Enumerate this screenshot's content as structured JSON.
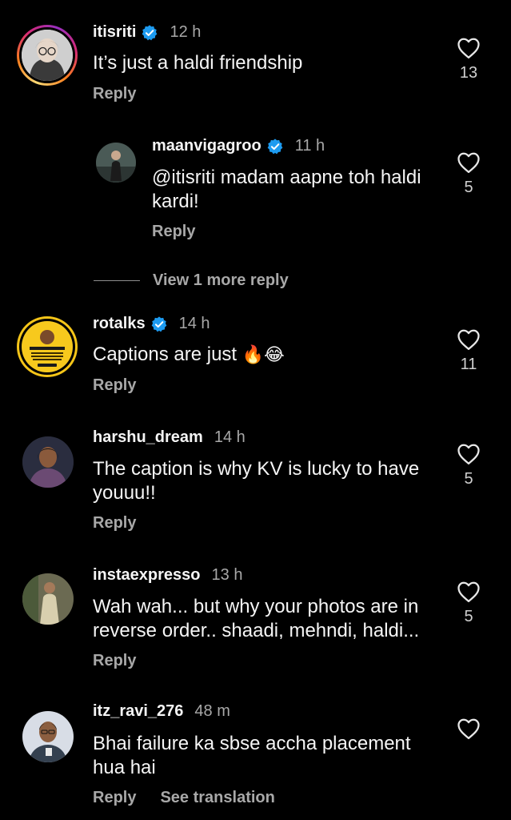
{
  "colors": {
    "background": "#000000",
    "text": "#f5f5f5",
    "muted": "#a8a8a8",
    "verified": "#1d9bf0",
    "story_ring": [
      "#feda75",
      "#fa7e1e",
      "#d62976",
      "#962fbf"
    ],
    "rotalks_ring": "#f5c518"
  },
  "comments": [
    {
      "username": "itisriti",
      "verified": true,
      "time": "12 h",
      "text": "It’s just a haldi friendship",
      "likes": "13",
      "reply_label": "Reply",
      "avatar_icon": "profile-photo"
    },
    {
      "username": "maanvigagroo",
      "verified": true,
      "time": "11 h",
      "text_line1": "@itisriti madam aapne toh haldi",
      "text_line2": "kardi!",
      "likes": "5",
      "reply_label": "Reply",
      "avatar_icon": "profile-photo"
    },
    {
      "username": "rotalks",
      "verified": true,
      "time": "14 h",
      "text": "Captions are just",
      "emojis": "🔥😂",
      "likes": "11",
      "reply_label": "Reply",
      "avatar_icon": "profile-photo"
    },
    {
      "username": "harshu_dream",
      "verified": false,
      "time": "14 h",
      "text_line1": "The caption is why KV is lucky to have",
      "text_line2": "youuu!!",
      "likes": "5",
      "reply_label": "Reply",
      "avatar_icon": "profile-photo"
    },
    {
      "username": "instaexpresso",
      "verified": false,
      "time": "13 h",
      "text_line1": "Wah wah... but why your photos are in",
      "text_line2": "reverse order.. shaadi, mehndi, haldi...",
      "likes": "5",
      "reply_label": "Reply",
      "avatar_icon": "profile-photo"
    },
    {
      "username": "itz_ravi_276",
      "verified": false,
      "time": "48 m",
      "text_line1": "Bhai failure ka sbse accha placement",
      "text_line2": "hua hai",
      "likes": "",
      "reply_label": "Reply",
      "translate_label": "See translation",
      "avatar_icon": "profile-photo"
    }
  ],
  "view_more_replies": "View 1 more reply"
}
